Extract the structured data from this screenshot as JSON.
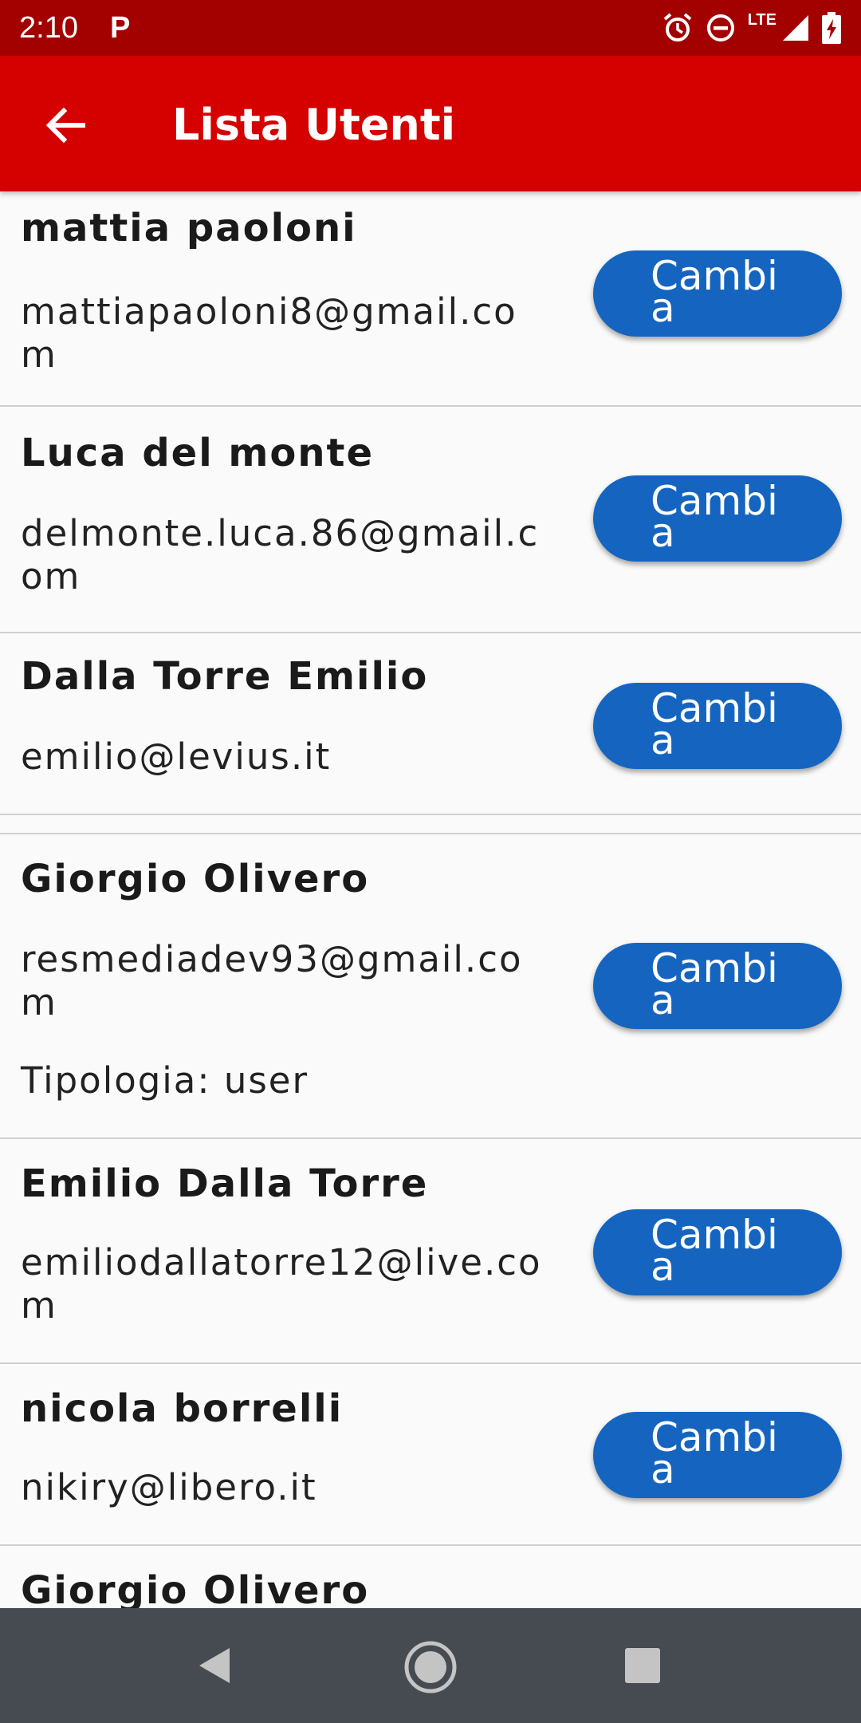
{
  "status_bar": {
    "time": "2:10",
    "notification_letter": "P",
    "network": "LTE",
    "icons": [
      "alarm-icon",
      "do-not-disturb-icon",
      "signal-icon",
      "battery-charging-icon"
    ]
  },
  "app_bar": {
    "title": "Lista Utenti",
    "back_icon": "arrow-back-icon",
    "color": "#d50000"
  },
  "users": [
    {
      "name": "mattia paoloni",
      "email": "mattiapaoloni8@gmail.com",
      "type": "",
      "button": "Cambia"
    },
    {
      "name": "Luca del monte",
      "email": "delmonte.luca.86@gmail.com",
      "type": "",
      "button": "Cambia"
    },
    {
      "name": "Dalla Torre Emilio",
      "email": "emilio@levius.it",
      "type": "",
      "button": "Cambia"
    },
    {
      "name": "Giorgio Olivero",
      "email": "resmediadev93@gmail.com",
      "type": "Tipologia: user",
      "button": "Cambia"
    },
    {
      "name": "Emilio Dalla Torre",
      "email": "emiliodallatorre12@live.com",
      "type": "",
      "button": "Cambia"
    },
    {
      "name": "nicola borrelli",
      "email": "nikiry@libero.it",
      "type": "",
      "button": "Cambia"
    },
    {
      "name": "Giorgio Olivero",
      "email": "",
      "type": "",
      "button": ""
    }
  ],
  "nav_bar": {
    "icons": [
      "back-triangle-icon",
      "home-circle-icon",
      "recents-square-icon"
    ]
  },
  "colors": {
    "status_bar": "#a30000",
    "button": "#1565c0",
    "nav_bar": "#464b51"
  }
}
